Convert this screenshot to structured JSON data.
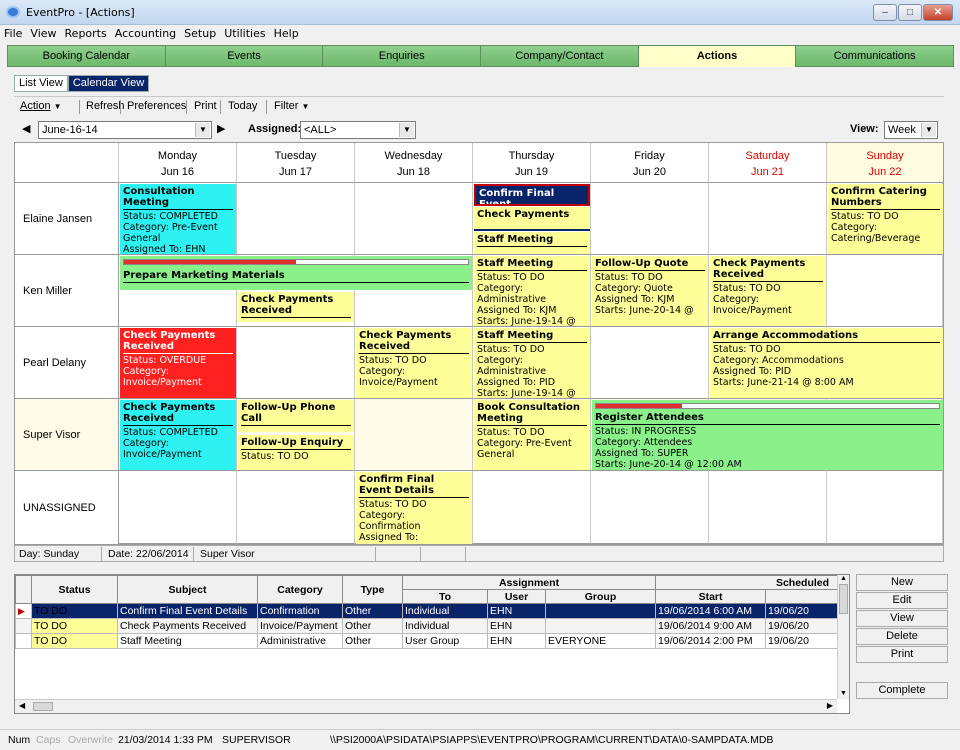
{
  "window": {
    "title": "EventPro - [Actions]",
    "controls": [
      "minimize",
      "restore",
      "close"
    ]
  },
  "menu": [
    "File",
    "View",
    "Reports",
    "Accounting",
    "Setup",
    "Utilities",
    "Help"
  ],
  "main_tabs": [
    "Booking Calendar",
    "Events",
    "Enquiries",
    "Company/Contact",
    "Actions",
    "Communications"
  ],
  "active_main_tab": "Actions",
  "sub_tabs": [
    "List View",
    "Calendar View"
  ],
  "toolbar": {
    "action": "Action",
    "refresh": "Refresh",
    "preferences": "Preferences",
    "print": "Print",
    "today": "Today",
    "filter": "Filter"
  },
  "filters": {
    "date": "June-16-14",
    "assigned_label": "Assigned:",
    "assigned_value": "<ALL>",
    "view_label": "View:",
    "view_value": "Week"
  },
  "days": [
    {
      "dow": "Monday",
      "date": "Jun 16"
    },
    {
      "dow": "Tuesday",
      "date": "Jun 17"
    },
    {
      "dow": "Wednesday",
      "date": "Jun 18"
    },
    {
      "dow": "Thursday",
      "date": "Jun 19"
    },
    {
      "dow": "Friday",
      "date": "Jun 20"
    },
    {
      "dow": "Saturday",
      "date": "Jun 21"
    },
    {
      "dow": "Sunday",
      "date": "Jun 22"
    }
  ],
  "rows": [
    "Elaine Jansen",
    "Ken Miller",
    "Pearl Delany",
    "Super Visor",
    "UNASSIGNED"
  ],
  "events": {
    "e1": {
      "title": "Consultation Meeting",
      "l1": "Status: COMPLETED",
      "l2": "Category: Pre-Event",
      "l3": "General",
      "l4": "Assigned To: EHN"
    },
    "e2": {
      "title": "Confirm Final Event"
    },
    "e3": {
      "title": "Check Payments"
    },
    "e4": {
      "title": "Staff Meeting"
    },
    "e5": {
      "title": "Confirm Catering Numbers",
      "l1": "Status: TO DO",
      "l2": "Category:",
      "l3": "Catering/Beverage"
    },
    "e6": {
      "title": "Prepare Marketing Materials"
    },
    "e7": {
      "title": "Check Payments Received"
    },
    "e8": {
      "title": "Staff Meeting",
      "l1": "Status: TO DO",
      "l2": "Category: Administrative",
      "l3": "Assigned To: KJM",
      "l4": "Starts: June-19-14 @"
    },
    "e9": {
      "title": "Follow-Up Quote",
      "l1": "Status: TO DO",
      "l2": "Category: Quote",
      "l3": "Assigned To: KJM",
      "l4": "Starts: June-20-14 @"
    },
    "e10": {
      "title": "Check Payments Received",
      "l1": "Status: TO DO",
      "l2": "Category:",
      "l3": "Invoice/Payment"
    },
    "e11": {
      "title": "Check Payments Received",
      "l1": "Status: OVERDUE",
      "l2": "Category:",
      "l3": "Invoice/Payment"
    },
    "e12": {
      "title": "Check Payments Received",
      "l1": "Status: TO DO",
      "l2": "Category:",
      "l3": "Invoice/Payment"
    },
    "e13": {
      "title": "Staff Meeting",
      "l1": "Status: TO DO",
      "l2": "Category: Administrative",
      "l3": "Assigned To: PID",
      "l4": "Starts: June-19-14 @"
    },
    "e14": {
      "title": "Arrange Accommodations",
      "l1": "Status: TO DO",
      "l2": "Category: Accommodations",
      "l3": "Assigned To: PID",
      "l4": "Starts: June-21-14 @ 8:00 AM"
    },
    "e15": {
      "title": "Check Payments Received",
      "l1": "Status: COMPLETED",
      "l2": "Category:",
      "l3": "Invoice/Payment"
    },
    "e16": {
      "title": "Follow-Up Phone Call"
    },
    "e17": {
      "title": "Follow-Up Enquiry",
      "l1": "Status: TO DO"
    },
    "e18": {
      "title": "Book Consultation Meeting",
      "l1": "Status: TO DO",
      "l2": "Category: Pre-Event",
      "l3": "General"
    },
    "e19": {
      "title": "Register Attendees",
      "l1": "Status: IN PROGRESS",
      "l2": "Category: Attendees",
      "l3": "Assigned To: SUPER",
      "l4": "Starts: June-20-14 @ 12:00 AM"
    },
    "e20": {
      "title": "Confirm Final Event Details",
      "l1": "Status: TO DO",
      "l2": "Category: Confirmation",
      "l3": "Assigned To:"
    }
  },
  "progress": {
    "e6": 0.5,
    "e19": 0.25
  },
  "status_row": {
    "day": "Day: Sunday",
    "date": "Date: 22/06/2014",
    "user": "Super Visor"
  },
  "grid": {
    "headers": {
      "status": "Status",
      "subject": "Subject",
      "category": "Category",
      "type": "Type",
      "assignment": "Assignment",
      "to": "To",
      "user": "User",
      "group": "Group",
      "scheduled": "Scheduled",
      "start": "Start"
    },
    "rows": [
      {
        "status": "TO DO",
        "subject": "Confirm Final Event Details",
        "category": "Confirmation",
        "type": "Other",
        "to": "Individual",
        "user": "EHN",
        "group": "",
        "start": "19/06/2014 6:00 AM",
        "end": "19/06/20"
      },
      {
        "status": "TO DO",
        "subject": "Check Payments Received",
        "category": "Invoice/Payment",
        "type": "Other",
        "to": "Individual",
        "user": "EHN",
        "group": "",
        "start": "19/06/2014 9:00 AM",
        "end": "19/06/20"
      },
      {
        "status": "TO DO",
        "subject": "Staff Meeting",
        "category": "Administrative",
        "type": "Other",
        "to": "User Group",
        "user": "EHN",
        "group": "EVERYONE",
        "start": "19/06/2014 2:00 PM",
        "end": "19/06/20"
      }
    ]
  },
  "side_buttons": {
    "new": "New",
    "edit": "Edit",
    "view": "View",
    "delete": "Delete",
    "print": "Print",
    "complete": "Complete"
  },
  "bottom_status": {
    "num": "Num",
    "caps": "Caps",
    "overwrite": "Overwrite",
    "datetime": "21/03/2014 1:33 PM",
    "user": "SUPERVISOR",
    "path": "\\\\PSI2000A\\PSIDATA\\PSIAPPS\\EVENTPRO\\PROGRAM\\CURRENT\\DATA\\0-SAMPDATA.MDB"
  },
  "colors": {
    "completed": "#2ef2f2",
    "todo": "#ffff99",
    "in_progress": "#8af08a",
    "overdue": "#ff2020",
    "tab": "#8fd08f",
    "selection": "#0a246a"
  }
}
